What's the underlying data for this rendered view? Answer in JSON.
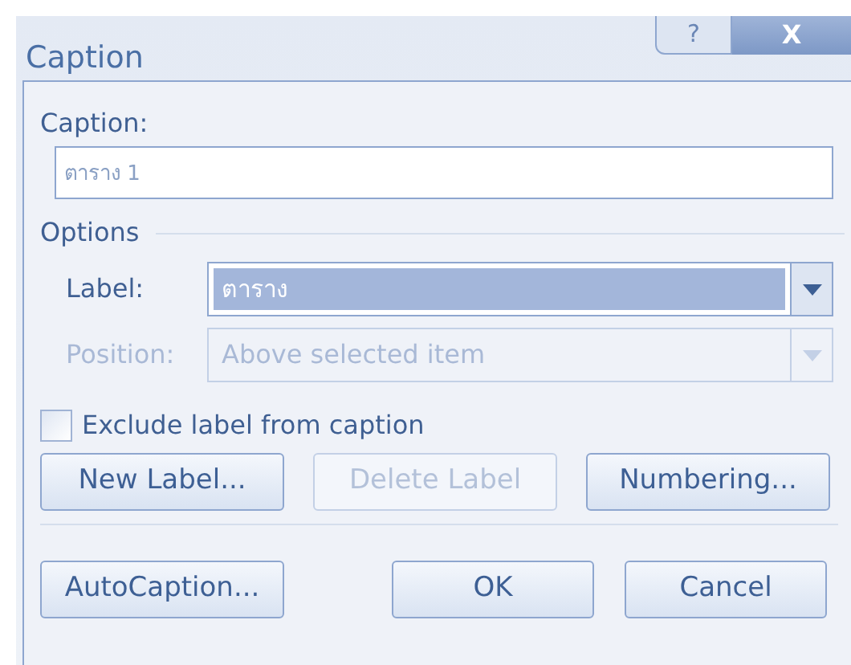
{
  "window": {
    "title": "Caption",
    "help_button": "?",
    "close_button": "X"
  },
  "caption": {
    "label": "Caption:",
    "value": "ตาราง 1"
  },
  "options": {
    "title": "Options",
    "fields": [
      {
        "label": "Label:",
        "value": "ตาราง",
        "disabled": false,
        "selected": true
      },
      {
        "label": "Position:",
        "value": "Above selected item",
        "disabled": true,
        "selected": false
      }
    ]
  },
  "exclude_label": {
    "label": "Exclude label from caption",
    "checked": false
  },
  "label_buttons": [
    {
      "label": "New Label...",
      "disabled": false
    },
    {
      "label": "Delete Label",
      "disabled": true
    },
    {
      "label": "Numbering...",
      "disabled": false
    }
  ],
  "footer_buttons": [
    {
      "label": "AutoCaption...",
      "disabled": false
    },
    {
      "label": "OK",
      "disabled": false
    },
    {
      "label": "Cancel",
      "disabled": false
    }
  ]
}
